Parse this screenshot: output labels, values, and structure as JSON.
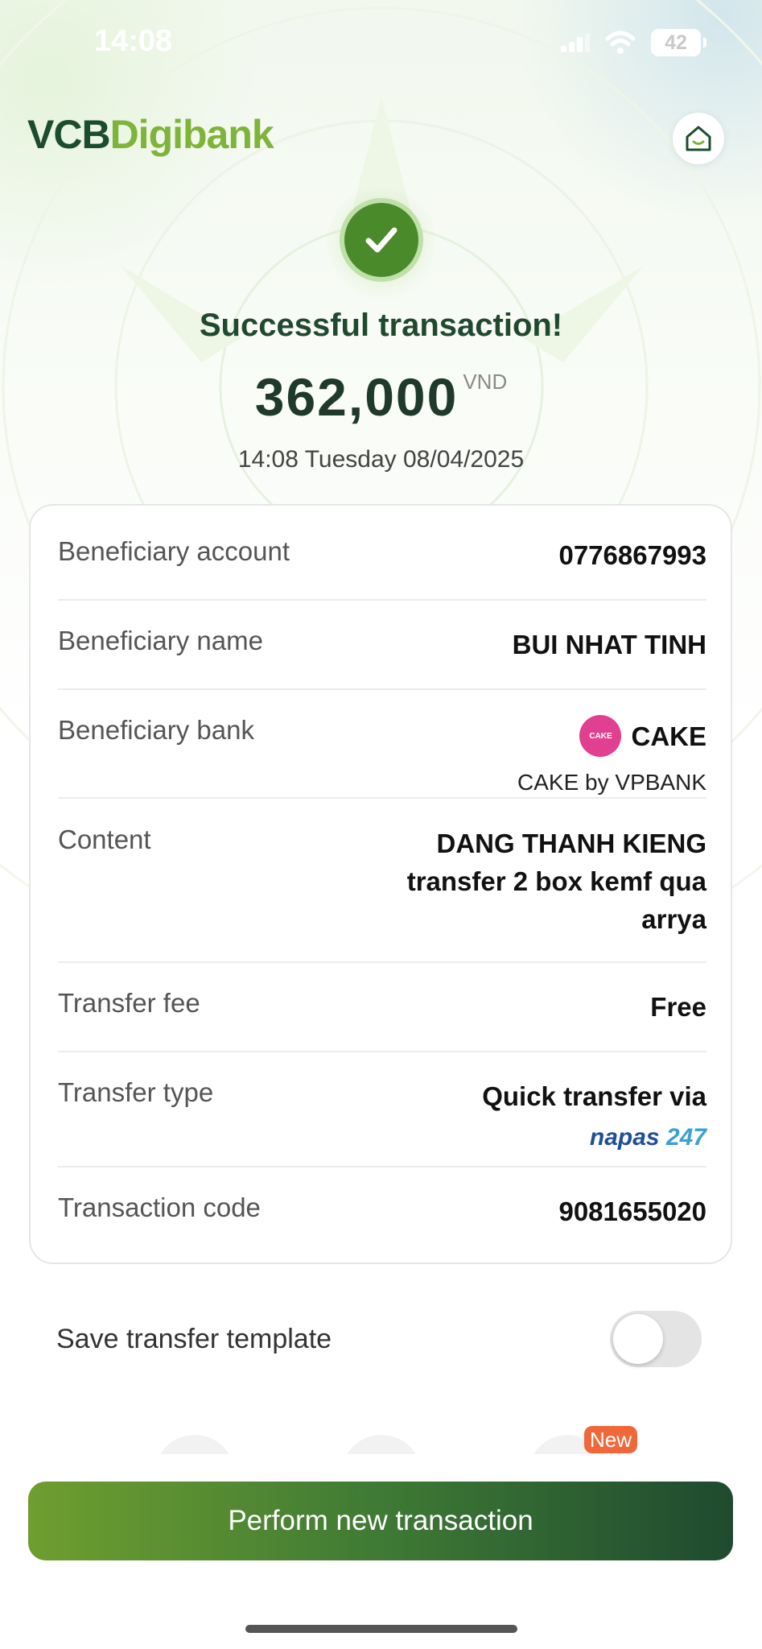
{
  "status_bar": {
    "time": "14:08",
    "battery": "42"
  },
  "header": {
    "logo_part1": "VCB",
    "logo_part2": "Digibank"
  },
  "result": {
    "title": "Successful transaction!",
    "amount": "362,000",
    "currency": "VND",
    "datetime": "14:08 Tuesday 08/04/2025"
  },
  "details": {
    "beneficiary_account": {
      "label": "Beneficiary account",
      "value": "0776867993"
    },
    "beneficiary_name": {
      "label": "Beneficiary name",
      "value": "BUI NHAT TINH"
    },
    "beneficiary_bank": {
      "label": "Beneficiary bank",
      "logo_text": "CAKE",
      "value": "CAKE",
      "sub": "CAKE by VPBANK"
    },
    "content": {
      "label": "Content",
      "line1": "DANG THANH KIENG",
      "line2": "transfer 2 box kemf qua",
      "line3": "arrya"
    },
    "transfer_fee": {
      "label": "Transfer fee",
      "value": "Free"
    },
    "transfer_type": {
      "label": "Transfer type",
      "value": "Quick transfer via",
      "napas_part1": "napas",
      "napas_part2": "247"
    },
    "transaction_code": {
      "label": "Transaction code",
      "value": "9081655020"
    }
  },
  "save_template": {
    "label": "Save transfer template",
    "enabled": false
  },
  "badge": {
    "new": "New"
  },
  "actions": {
    "primary": "Perform new transaction"
  },
  "colors": {
    "brand_dark": "#1c4c2e",
    "brand_green": "#7fb43a",
    "success": "#4a8a2a",
    "badge": "#f0683a",
    "cake": "#e0408f"
  }
}
